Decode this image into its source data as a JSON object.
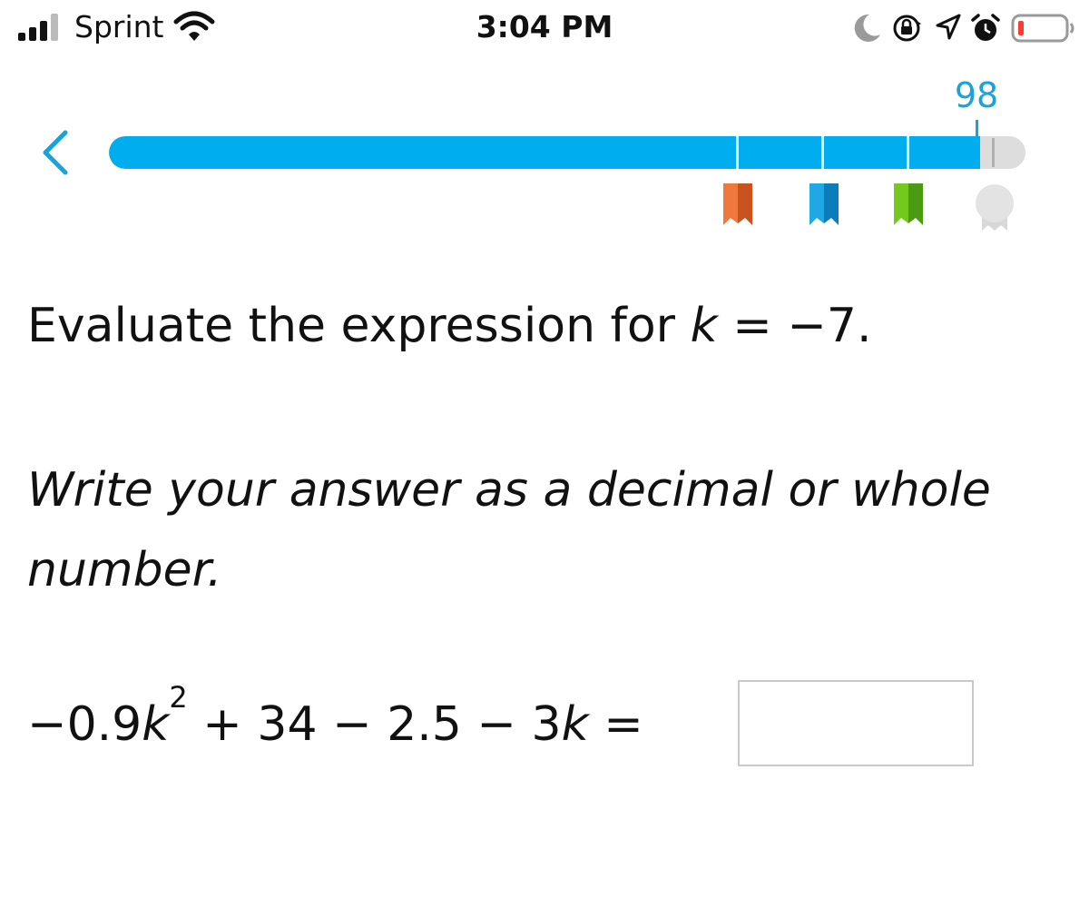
{
  "status_bar": {
    "carrier": "Sprint",
    "time": "3:04 PM",
    "icons": [
      "signal-icon",
      "wifi-icon",
      "moon-icon",
      "rotation-lock-icon",
      "location-icon",
      "alarm-icon",
      "battery-icon"
    ],
    "battery_level": "low",
    "battery_color": "#ff3b30"
  },
  "progress": {
    "score": "98",
    "fill_percent": 95,
    "accent_color": "#00aeef",
    "awards": [
      {
        "icon": "orange-ribbon-icon",
        "color": "#e86a2c",
        "earned": true
      },
      {
        "icon": "blue-ribbon-icon",
        "color": "#1493d4",
        "earned": true
      },
      {
        "icon": "green-ribbon-icon",
        "color": "#5db51c",
        "earned": true
      },
      {
        "icon": "medal-icon",
        "color": "#dedede",
        "earned": false
      }
    ]
  },
  "question": {
    "prompt_prefix": "Evaluate the expression for ",
    "prompt_var": "k",
    "prompt_suffix": " = −7.",
    "instructions": "Write your answer as a decimal or whole number.",
    "expression": {
      "part1": "−0.9",
      "var1": "k",
      "exp": "2",
      "part2": " + 34 − 2.5 − 3",
      "var2": "k",
      "part3": " ="
    },
    "answer_value": ""
  }
}
